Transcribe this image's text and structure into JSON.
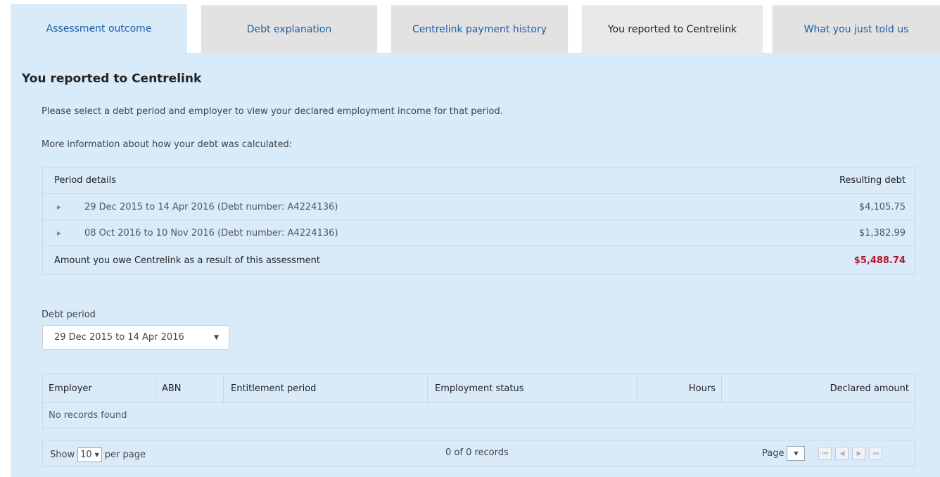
{
  "tabs": [
    {
      "label": "Assessment outcome"
    },
    {
      "label": "Debt explanation"
    },
    {
      "label": "Centrelink payment history"
    },
    {
      "label": "You reported to Centrelink"
    },
    {
      "label": "What you just told us"
    }
  ],
  "page": {
    "title": "You reported to Centrelink",
    "intro": "Please select a debt period and employer to view your declared employment income for that period.",
    "more_info": "More information about how your debt was calculated:"
  },
  "period_table": {
    "header_left": "Period details",
    "header_right": "Resulting debt",
    "rows": [
      {
        "label": "29 Dec 2015 to 14 Apr 2016 (Debt number: A4224136)",
        "amount": "$4,105.75"
      },
      {
        "label": "08 Oct 2016 to 10 Nov 2016 (Debt number: A4224136)",
        "amount": "$1,382.99"
      }
    ],
    "total_label": "Amount you owe Centrelink as a result of this assessment",
    "total_amount": "$5,488.74",
    "total_color": "#b8142a"
  },
  "debt_period": {
    "label": "Debt period",
    "selected": "29 Dec 2015 to 14 Apr 2016"
  },
  "employment_table": {
    "columns": [
      "Employer",
      "ABN",
      "Entitlement period",
      "Employment status",
      "Hours",
      "Declared amount"
    ],
    "empty_message": "No records found"
  },
  "pager": {
    "show_label": "Show",
    "per_page_value": "10",
    "per_page_label": "per page",
    "records": "0 of 0 records",
    "page_label": "Page"
  },
  "colors": {
    "panel_bg": "#d9eaf9",
    "tab_link": "#1d5fa6"
  }
}
